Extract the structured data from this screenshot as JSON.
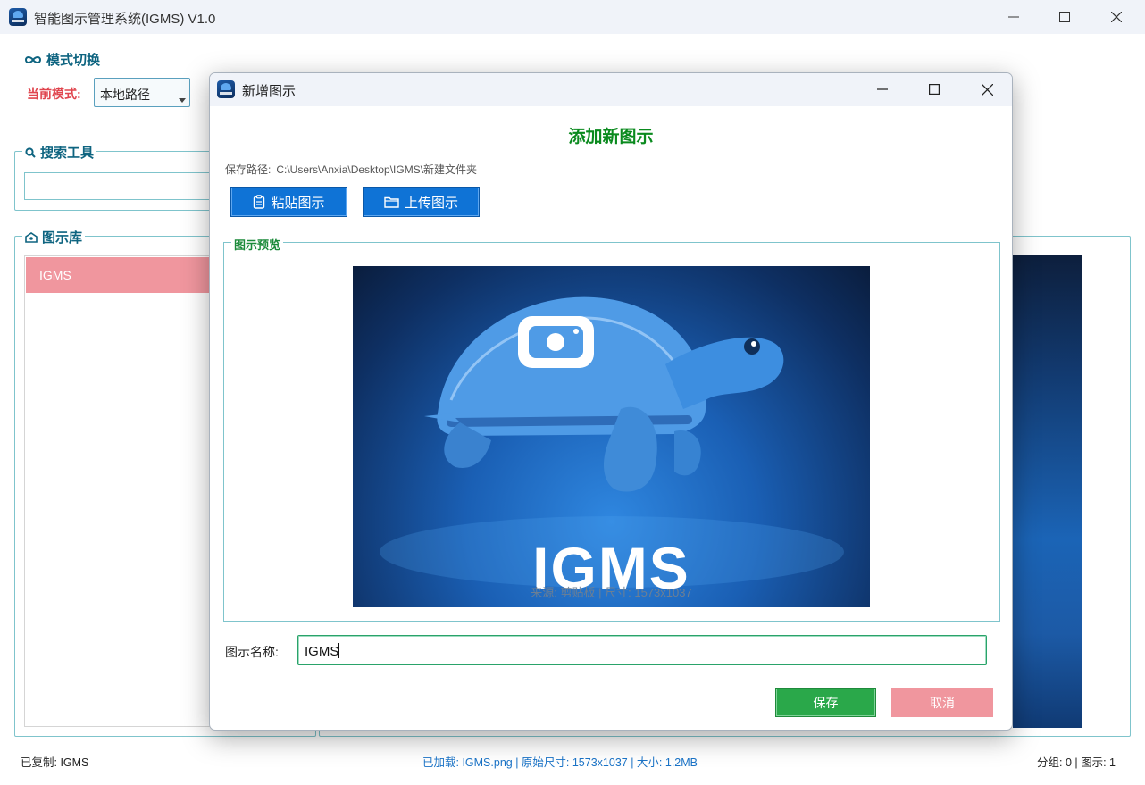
{
  "main_window": {
    "title": "智能图示管理系统(IGMS) V1.0",
    "mode_section": {
      "title": "模式切换",
      "current_mode_label": "当前模式:",
      "current_mode_value": "本地路径"
    },
    "search_section": {
      "title": "搜索工具",
      "query": ""
    },
    "library_section": {
      "title": "图示库",
      "items": [
        {
          "label": "IGMS",
          "selected": true
        }
      ]
    }
  },
  "status_bar": {
    "left": "已复制: IGMS",
    "center": "已加载: IGMS.png | 原始尺寸: 1573x1037 | 大小: 1.2MB",
    "right": "分组: 0 | 图示: 1"
  },
  "dialog": {
    "title": "新增图示",
    "heading": "添加新图示",
    "save_path_label": "保存路径:",
    "save_path_value": "C:\\Users\\Anxia\\Desktop\\IGMS\\新建文件夹",
    "paste_button": "粘贴图示",
    "upload_button": "上传图示",
    "preview_title": "图示预览",
    "preview_image_text": "IGMS",
    "preview_caption": "来源: 剪贴板 | 尺寸: 1573x1037",
    "name_label": "图示名称:",
    "name_value": "IGMS",
    "save_button": "保存",
    "cancel_button": "取消"
  },
  "colors": {
    "accent_teal": "#0e6480",
    "danger_label": "#e0454e",
    "primary_blue": "#0f73d6",
    "success_green": "#2aa84a",
    "heading_green": "#0a8a1e",
    "cancel_pink": "#f0969e",
    "status_blue": "#1a73c7"
  },
  "icons": [
    "app-logo-icon",
    "infinity-icon",
    "search-icon",
    "image-library-icon",
    "clipboard-icon",
    "folder-icon",
    "minimize-icon",
    "maximize-icon",
    "close-icon"
  ]
}
